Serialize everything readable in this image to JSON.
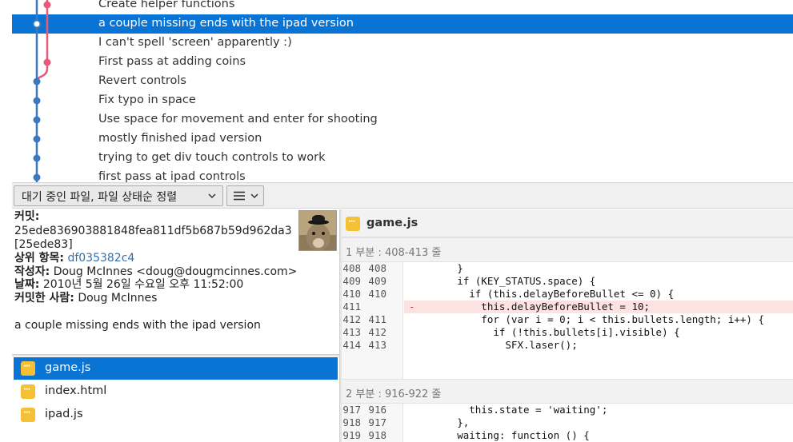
{
  "commits": [
    {
      "message": "Create helper functions",
      "selected": false
    },
    {
      "message": "a couple missing ends with the ipad version",
      "selected": true
    },
    {
      "message": "I can't spell 'screen' apparently :)",
      "selected": false
    },
    {
      "message": "First pass at adding coins",
      "selected": false
    },
    {
      "message": "Revert controls",
      "selected": false
    },
    {
      "message": "Fix typo in space",
      "selected": false
    },
    {
      "message": "Use space for movement and enter for shooting",
      "selected": false
    },
    {
      "message": "mostly finished ipad version",
      "selected": false
    },
    {
      "message": "trying to get div touch controls to work",
      "selected": false
    },
    {
      "message": "first pass at ipad controls",
      "selected": false
    }
  ],
  "graph_colors": {
    "main": "#3a78c0",
    "branch": "#e55a78",
    "selected_node": "#ffffff"
  },
  "toolbar": {
    "sort_label": "대기 중인 파일, 파일 상태순 정렬",
    "sort_icon": "chevron-down-icon",
    "view_icon": "list-icon"
  },
  "details": {
    "commit_label": "커밋:",
    "commit_hash": "25ede836903881848fea811df5b687b59d962da3",
    "commit_short": "[25ede83]",
    "parent_label": "상위 항목:",
    "parent_hash": "df035382c4",
    "author_label": "작성자:",
    "author_value": "Doug McInnes <doug@dougmcinnes.com>",
    "date_label": "날짜:",
    "date_value": "2010년 5월 26일 수요일 오후 11:52:00",
    "committer_label": "커밋한 사람:",
    "committer_value": "Doug McInnes",
    "message": "a couple missing ends with the ipad version"
  },
  "files": [
    {
      "name": "game.js",
      "selected": true
    },
    {
      "name": "index.html",
      "selected": false
    },
    {
      "name": "ipad.js",
      "selected": false
    }
  ],
  "diff": {
    "file": "game.js",
    "hunk1": {
      "header": "1 부분 : 408-413 줄",
      "lines": [
        {
          "old": "408",
          "new": "408",
          "mark": "",
          "text": "        }",
          "type": "context"
        },
        {
          "old": "409",
          "new": "409",
          "mark": "",
          "text": "        if (KEY_STATUS.space) {",
          "type": "context"
        },
        {
          "old": "410",
          "new": "410",
          "mark": "",
          "text": "          if (this.delayBeforeBullet <= 0) {",
          "type": "context"
        },
        {
          "old": "411",
          "new": "",
          "mark": "-",
          "text": "            this.delayBeforeBullet = 10;",
          "type": "removed"
        },
        {
          "old": "412",
          "new": "411",
          "mark": "",
          "text": "            for (var i = 0; i < this.bullets.length; i++) {",
          "type": "context"
        },
        {
          "old": "413",
          "new": "412",
          "mark": "",
          "text": "              if (!this.bullets[i].visible) {",
          "type": "context"
        },
        {
          "old": "414",
          "new": "413",
          "mark": "",
          "text": "                SFX.laser();",
          "type": "context"
        }
      ]
    },
    "hunk2": {
      "header": "2 부분 : 916-922 줄",
      "lines": [
        {
          "old": "917",
          "new": "916",
          "mark": "",
          "text": "          this.state = 'waiting';",
          "type": "context"
        },
        {
          "old": "918",
          "new": "917",
          "mark": "",
          "text": "        },",
          "type": "context"
        },
        {
          "old": "919",
          "new": "918",
          "mark": "",
          "text": "        waiting: function () {",
          "type": "context"
        }
      ]
    }
  }
}
